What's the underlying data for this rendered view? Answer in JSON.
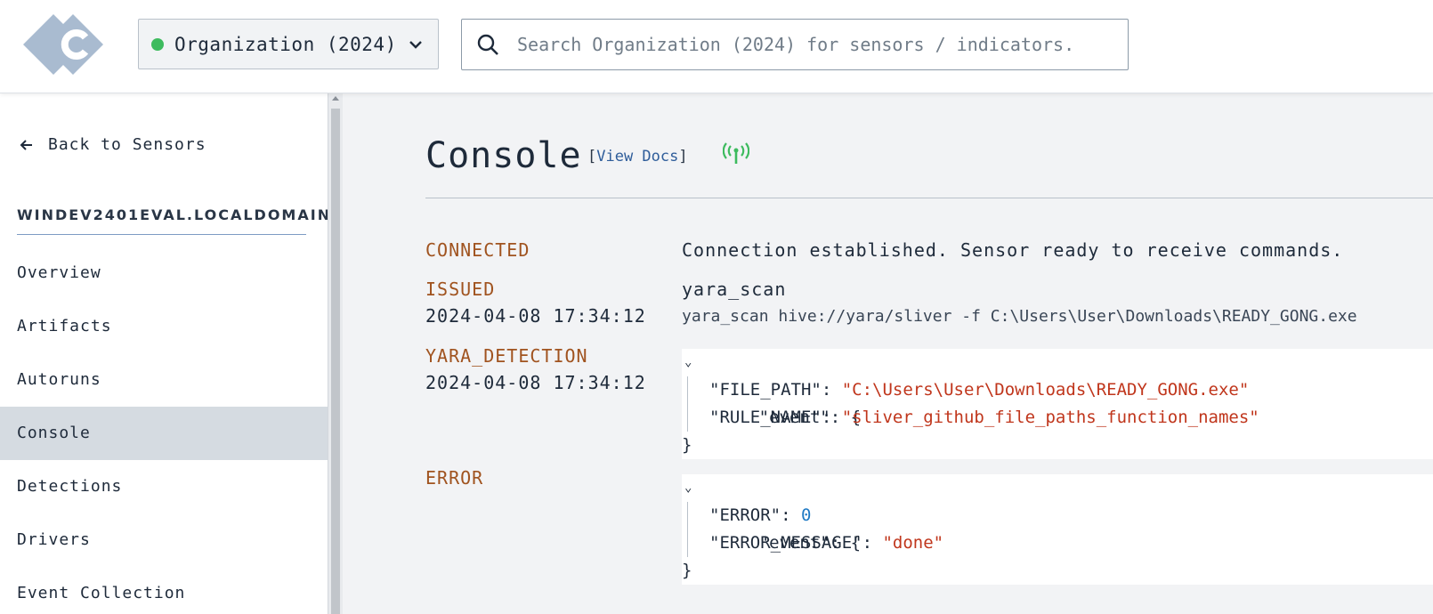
{
  "header": {
    "org_name": "Organization (2024)",
    "org_status_color": "#3dbb5e",
    "search_placeholder": "Search Organization (2024) for sensors / indicators."
  },
  "sidebar": {
    "back_label": "Back to Sensors",
    "hostname": "WINDEV2401EVAL.LOCALDOMAIN",
    "items": [
      {
        "label": "Overview"
      },
      {
        "label": "Artifacts"
      },
      {
        "label": "Autoruns"
      },
      {
        "label": "Console",
        "active": true
      },
      {
        "label": "Detections"
      },
      {
        "label": "Drivers"
      },
      {
        "label": "Event Collection"
      }
    ]
  },
  "main": {
    "title": "Console",
    "docs_open": "[",
    "docs_label": "View Docs",
    "docs_close": "]",
    "entries": {
      "connected": {
        "label": "CONNECTED",
        "message": "Connection established. Sensor ready to receive commands."
      },
      "issued": {
        "label": "ISSUED",
        "time": "2024-04-08 17:34:12",
        "command": "yara_scan",
        "command_line": "yara_scan hive://yara/sliver -f C:\\Users\\User\\Downloads\\READY_GONG.exe"
      },
      "yara": {
        "label": "YARA_DETECTION",
        "time": "2024-04-08 17:34:12",
        "event_key": "\"event\": {",
        "close": "}",
        "fields": [
          {
            "key": "\"FILE_PATH\": ",
            "value": "\"C:\\Users\\User\\Downloads\\READY_GONG.exe\""
          },
          {
            "key": "\"RULE_NAME\": ",
            "value": "\"sliver_github_file_paths_function_names\""
          }
        ]
      },
      "error": {
        "label": "ERROR",
        "event_key": "\"event\": {",
        "close": "}",
        "fields": [
          {
            "key": "\"ERROR\": ",
            "value": "0"
          },
          {
            "key": "\"ERROR_MESSAGE\": ",
            "value": "\"done\""
          }
        ]
      }
    }
  }
}
